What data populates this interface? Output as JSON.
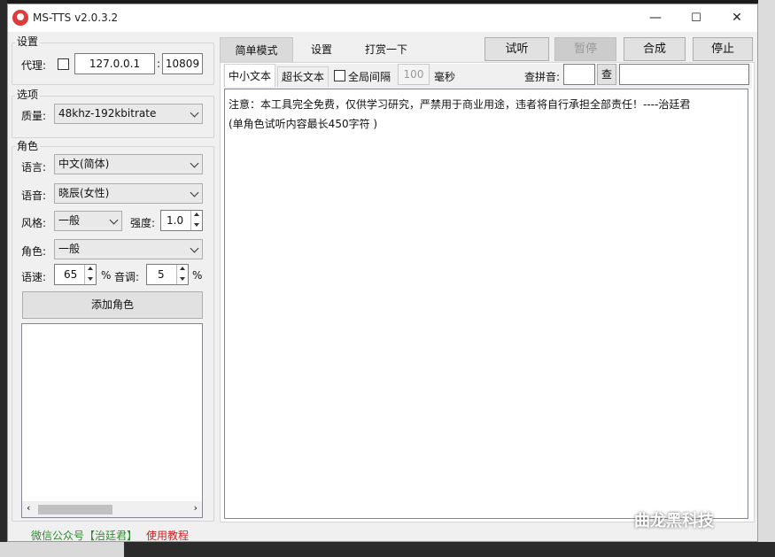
{
  "window": {
    "title": "MS-TTS v2.0.3.2",
    "minimize": "—",
    "maximize": "☐",
    "close": "✕"
  },
  "settings": {
    "group_label": "设置",
    "proxy_label": "代理:",
    "proxy_host": "127.0.0.1",
    "proxy_sep": ":",
    "proxy_port": "10809"
  },
  "options": {
    "group_label": "选项",
    "quality_label": "质量:",
    "quality_value": "48khz-192kbitrate"
  },
  "role": {
    "group_label": "角色",
    "language_label": "语言:",
    "language_value": "中文(简体)",
    "voice_label": "语音:",
    "voice_value": "晓辰(女性)",
    "style_label": "风格:",
    "style_value": "一般",
    "intensity_label": "强度:",
    "intensity_value": "1.0",
    "character_label": "角色:",
    "character_value": "一般",
    "speed_label": "语速:",
    "speed_value": "65",
    "speed_unit": "%",
    "pitch_label": "音调:",
    "pitch_value": "5",
    "pitch_unit": "%",
    "add_role_button": "添加角色"
  },
  "footer": {
    "wechat_link": "微信公众号【治廷君】",
    "tutorial_link": "使用教程"
  },
  "tabs": [
    {
      "label": "简单模式"
    },
    {
      "label": "设置"
    },
    {
      "label": "打赏一下"
    }
  ],
  "actions": {
    "preview": "试听",
    "pause": "暂停",
    "synthesize": "合成",
    "stop": "停止"
  },
  "subtabs": [
    {
      "label": "中小文本"
    },
    {
      "label": "超长文本"
    }
  ],
  "interval": {
    "label": "全局间隔",
    "value": "100",
    "unit": "毫秒"
  },
  "pinyin": {
    "label": "查拼音:",
    "button": "查"
  },
  "editor": {
    "line1": "注意：本工具完全免费，仅供学习研究，严禁用于商业用途，违者将自行承担全部责任！----治廷君",
    "line2": "(单角色试听内容最长450字符 )"
  },
  "watermark": "曲龙黑科技",
  "colors": {
    "link_green": "#2e8b2e",
    "link_red": "#d42020",
    "app_icon": "#e03b3b"
  }
}
